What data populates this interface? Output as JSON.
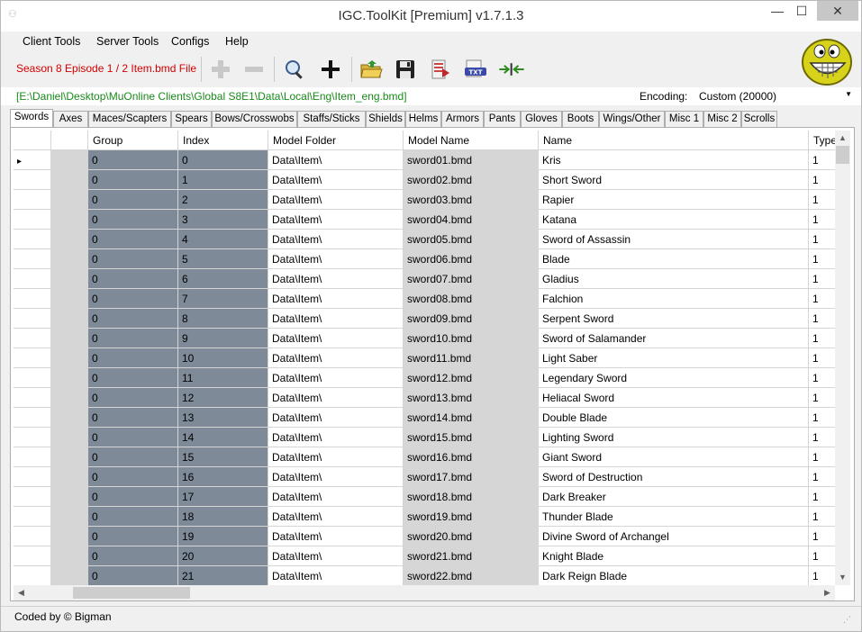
{
  "window": {
    "title": "IGC.ToolKit [Premium] v1.7.1.3",
    "controls": {
      "minimize": "—",
      "maximize": "☐",
      "close": "✕"
    }
  },
  "menu": {
    "client_tools": "Client Tools",
    "server_tools": "Server Tools",
    "configs": "Configs",
    "help": "Help"
  },
  "toolbar": {
    "file_label": "Season 8 Episode 1 / 2 Item.bmd File",
    "buttons": [
      "add-disabled-icon",
      "remove-disabled-icon",
      "search-icon",
      "add-icon",
      "open-folder-icon",
      "save-icon",
      "export-icon",
      "txt-icon",
      "merge-arrows-icon"
    ]
  },
  "pathbar": {
    "path": "[E:\\Daniel\\Desktop\\MuOnline Clients\\Global S8E1\\Data\\Local\\Eng\\Item_eng.bmd]",
    "encoding_label": "Encoding:",
    "encoding_value": "Custom (20000)"
  },
  "tabs": [
    "Swords",
    "Axes",
    "Maces/Scapters",
    "Spears",
    "Bows/Crosswobs",
    "Staffs/Sticks",
    "Shields",
    "Helms",
    "Armors",
    "Pants",
    "Gloves",
    "Boots",
    "Wings/Other",
    "Misc 1",
    "Misc 2",
    "Scrolls"
  ],
  "grid": {
    "columns": [
      "Group",
      "Index",
      "Model Folder",
      "Model Name",
      "Name",
      "Type"
    ],
    "current_row_marker": "▸",
    "rows": [
      [
        "0",
        "0",
        "Data\\Item\\",
        "sword01.bmd",
        "Kris",
        "1"
      ],
      [
        "0",
        "1",
        "Data\\Item\\",
        "sword02.bmd",
        "Short Sword",
        "1"
      ],
      [
        "0",
        "2",
        "Data\\Item\\",
        "sword03.bmd",
        "Rapier",
        "1"
      ],
      [
        "0",
        "3",
        "Data\\Item\\",
        "sword04.bmd",
        "Katana",
        "1"
      ],
      [
        "0",
        "4",
        "Data\\Item\\",
        "sword05.bmd",
        "Sword of Assassin",
        "1"
      ],
      [
        "0",
        "5",
        "Data\\Item\\",
        "sword06.bmd",
        "Blade",
        "1"
      ],
      [
        "0",
        "6",
        "Data\\Item\\",
        "sword07.bmd",
        "Gladius",
        "1"
      ],
      [
        "0",
        "7",
        "Data\\Item\\",
        "sword08.bmd",
        "Falchion",
        "1"
      ],
      [
        "0",
        "8",
        "Data\\Item\\",
        "sword09.bmd",
        "Serpent Sword",
        "1"
      ],
      [
        "0",
        "9",
        "Data\\Item\\",
        "sword10.bmd",
        "Sword of Salamander",
        "1"
      ],
      [
        "0",
        "10",
        "Data\\Item\\",
        "sword11.bmd",
        "Light Saber",
        "1"
      ],
      [
        "0",
        "11",
        "Data\\Item\\",
        "sword12.bmd",
        "Legendary Sword",
        "1"
      ],
      [
        "0",
        "12",
        "Data\\Item\\",
        "sword13.bmd",
        "Heliacal Sword",
        "1"
      ],
      [
        "0",
        "13",
        "Data\\Item\\",
        "sword14.bmd",
        "Double Blade",
        "1"
      ],
      [
        "0",
        "14",
        "Data\\Item\\",
        "sword15.bmd",
        "Lighting Sword",
        "1"
      ],
      [
        "0",
        "15",
        "Data\\Item\\",
        "sword16.bmd",
        "Giant Sword",
        "1"
      ],
      [
        "0",
        "16",
        "Data\\Item\\",
        "sword17.bmd",
        "Sword of Destruction",
        "1"
      ],
      [
        "0",
        "17",
        "Data\\Item\\",
        "sword18.bmd",
        "Dark Breaker",
        "1"
      ],
      [
        "0",
        "18",
        "Data\\Item\\",
        "sword19.bmd",
        "Thunder Blade",
        "1"
      ],
      [
        "0",
        "19",
        "Data\\Item\\",
        "sword20.bmd",
        "Divine Sword of Archangel",
        "1"
      ],
      [
        "0",
        "20",
        "Data\\Item\\",
        "sword21.bmd",
        "Knight Blade",
        "1"
      ],
      [
        "0",
        "21",
        "Data\\Item\\",
        "sword22.bmd",
        "Dark Reign Blade",
        "1"
      ]
    ]
  },
  "status": {
    "text": "Coded by © Bigman"
  },
  "colors": {
    "file_label": "#d40000",
    "path": "#1a8a1a",
    "readonly_cell": "#7f8a98",
    "alt_cell": "#d6d6d6"
  }
}
